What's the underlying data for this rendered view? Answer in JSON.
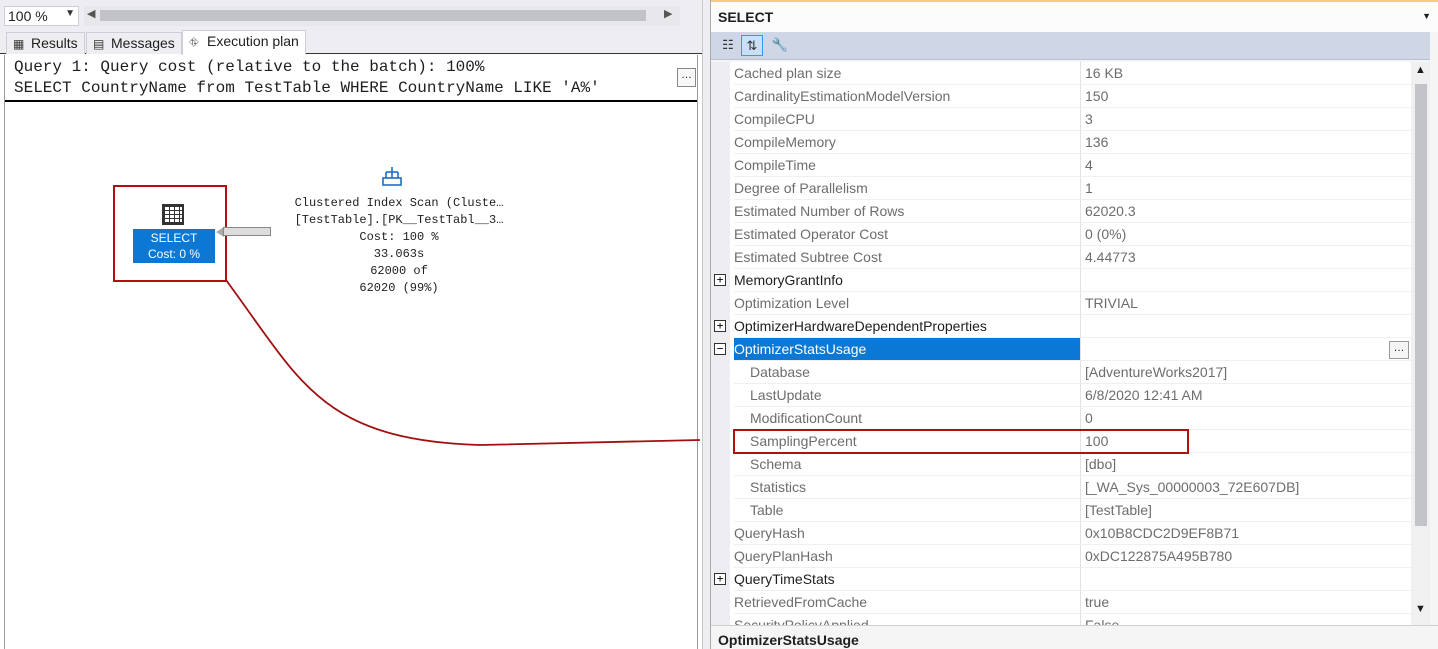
{
  "zoom": {
    "value": "100 %"
  },
  "tabs": [
    {
      "label": "Results",
      "icon": "grid-icon"
    },
    {
      "label": "Messages",
      "icon": "messages-icon"
    },
    {
      "label": "Execution plan",
      "icon": "execution-plan-icon"
    }
  ],
  "plan": {
    "query_line1": "Query 1: Query cost (relative to the batch): 100%",
    "query_line2": "SELECT CountryName from TestTable WHERE CountryName LIKE 'A%'",
    "select_node": {
      "label": "SELECT",
      "cost": "Cost: 0 %"
    },
    "scan_node": {
      "line1": "Clustered Index Scan (Cluste…",
      "line2": "[TestTable].[PK__TestTabl__3…",
      "line3": "Cost: 100 %",
      "line4": "33.063s",
      "line5": "62000 of",
      "line6": "62020 (99%)"
    }
  },
  "properties": {
    "header": "SELECT",
    "description_title": "OptimizerStatsUsage",
    "rows": [
      {
        "name": "Cached plan size",
        "value": "16 KB"
      },
      {
        "name": "CardinalityEstimationModelVersion",
        "value": "150"
      },
      {
        "name": "CompileCPU",
        "value": "3"
      },
      {
        "name": "CompileMemory",
        "value": "136"
      },
      {
        "name": "CompileTime",
        "value": "4"
      },
      {
        "name": "Degree of Parallelism",
        "value": "1"
      },
      {
        "name": "Estimated Number of Rows",
        "value": "62020.3"
      },
      {
        "name": "Estimated Operator Cost",
        "value": "0 (0%)"
      },
      {
        "name": "Estimated Subtree Cost",
        "value": "4.44773"
      },
      {
        "name": "MemoryGrantInfo",
        "value": "",
        "toggle": "⊞"
      },
      {
        "name": "Optimization Level",
        "value": "TRIVIAL"
      },
      {
        "name": "OptimizerHardwareDependentProperties",
        "value": "",
        "toggle": "⊞"
      },
      {
        "name": "OptimizerStatsUsage",
        "value": "",
        "toggle": "⊟"
      },
      {
        "name": "Database",
        "value": "[AdventureWorks2017]"
      },
      {
        "name": "LastUpdate",
        "value": "6/8/2020 12:41 AM"
      },
      {
        "name": "ModificationCount",
        "value": "0"
      },
      {
        "name": "SamplingPercent",
        "value": "100"
      },
      {
        "name": "Schema",
        "value": "[dbo]"
      },
      {
        "name": "Statistics",
        "value": "[_WA_Sys_00000003_72E607DB]"
      },
      {
        "name": "Table",
        "value": "[TestTable]"
      },
      {
        "name": "QueryHash",
        "value": "0x10B8CDC2D9EF8B71"
      },
      {
        "name": "QueryPlanHash",
        "value": "0xDC122875A495B780"
      },
      {
        "name": "QueryTimeStats",
        "value": "",
        "toggle": "⊞"
      },
      {
        "name": "RetrievedFromCache",
        "value": "true"
      },
      {
        "name": "SecurityPolicyApplied",
        "value": "False"
      }
    ]
  },
  "colors": {
    "accent": "#0a78d4",
    "highlight_border": "#b01010",
    "arrow": "#a01010"
  }
}
